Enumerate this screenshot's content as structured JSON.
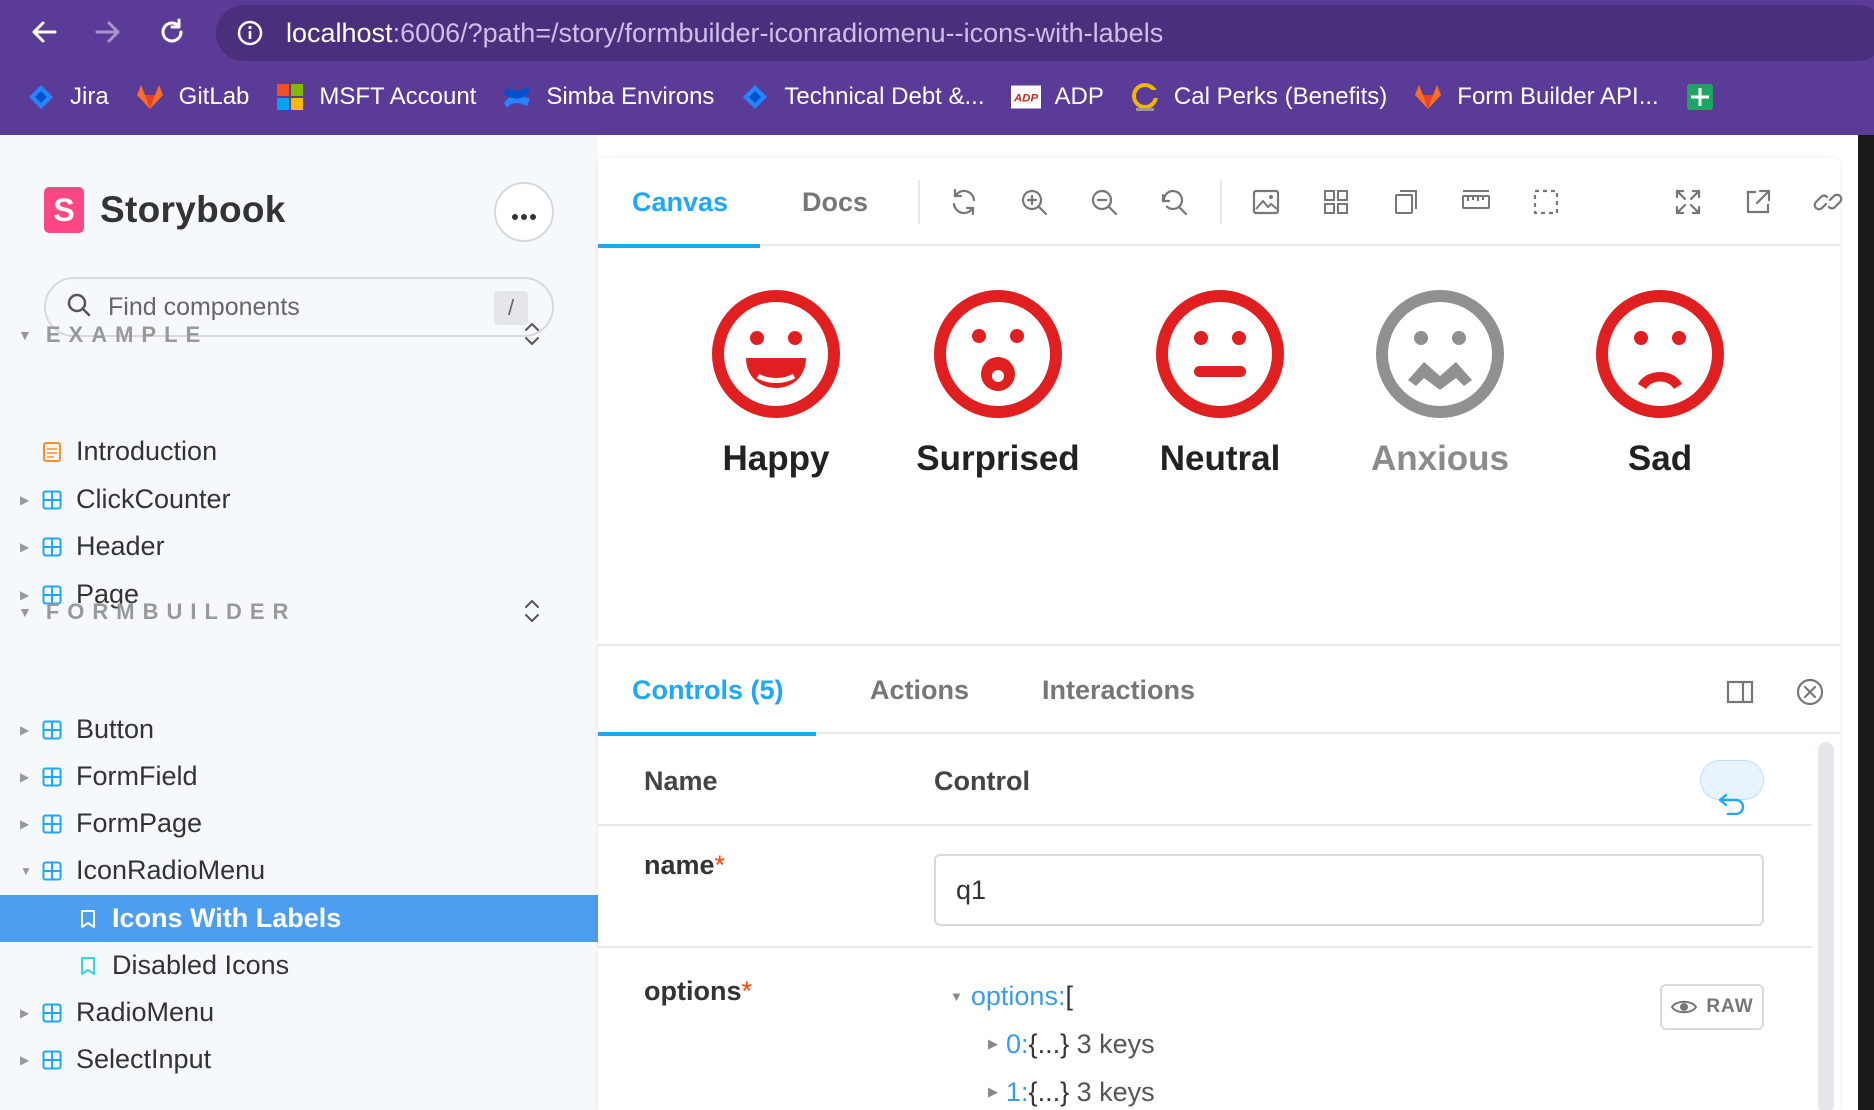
{
  "browser": {
    "url_host": "localhost",
    "url_rest": ":6006/?path=/story/formbuilder-iconradiomenu--icons-with-labels",
    "bookmarks": [
      {
        "label": "Jira",
        "icon": "jira-icon"
      },
      {
        "label": "GitLab",
        "icon": "gitlab-icon"
      },
      {
        "label": "MSFT Account",
        "icon": "microsoft-icon"
      },
      {
        "label": "Simba Environs",
        "icon": "confluence-icon"
      },
      {
        "label": "Technical Debt &...",
        "icon": "jira-icon"
      },
      {
        "label": "ADP",
        "icon": "adp-icon"
      },
      {
        "label": "Cal Perks (Benefits)",
        "icon": "calperks-icon"
      },
      {
        "label": "Form Builder API...",
        "icon": "gitlab-icon"
      }
    ]
  },
  "sidebar": {
    "brand": "Storybook",
    "search_placeholder": "Find components",
    "search_shortcut": "/",
    "sections": [
      {
        "title": "EXAMPLE",
        "items": [
          {
            "label": "Introduction",
            "kind": "doc"
          },
          {
            "label": "ClickCounter",
            "kind": "component"
          },
          {
            "label": "Header",
            "kind": "component"
          },
          {
            "label": "Page",
            "kind": "component"
          }
        ]
      },
      {
        "title": "FORMBUILDER",
        "items": [
          {
            "label": "Button",
            "kind": "component"
          },
          {
            "label": "FormField",
            "kind": "component"
          },
          {
            "label": "FormPage",
            "kind": "component"
          },
          {
            "label": "IconRadioMenu",
            "kind": "component",
            "expanded": true
          },
          {
            "label": "Icons With Labels",
            "kind": "story",
            "selected": true
          },
          {
            "label": "Disabled Icons",
            "kind": "story"
          },
          {
            "label": "RadioMenu",
            "kind": "component"
          },
          {
            "label": "SelectInput",
            "kind": "component"
          }
        ]
      }
    ]
  },
  "toolbar": {
    "tabs": [
      "Canvas",
      "Docs"
    ],
    "active_tab": "Canvas"
  },
  "canvas": {
    "faces": [
      {
        "label": "Happy",
        "mood": "happy",
        "disabled": false
      },
      {
        "label": "Surprised",
        "mood": "surprised",
        "disabled": false
      },
      {
        "label": "Neutral",
        "mood": "neutral",
        "disabled": false
      },
      {
        "label": "Anxious",
        "mood": "anxious",
        "disabled": true
      },
      {
        "label": "Sad",
        "mood": "sad",
        "disabled": false
      }
    ],
    "colors": {
      "active": "#e02020",
      "disabled": "#909090"
    }
  },
  "addons": {
    "tabs": [
      "Controls (5)",
      "Actions",
      "Interactions"
    ],
    "active_tab": "Controls (5)",
    "columns": {
      "name": "Name",
      "control": "Control"
    },
    "rows": {
      "name": {
        "label": "name",
        "required": "*",
        "value": "q1"
      },
      "options": {
        "label": "options",
        "required": "*",
        "tree_root_key": "options",
        "tree_root_sep": " : ",
        "tree_root_open": "[",
        "children": [
          {
            "key": "0",
            "sep": " : ",
            "value": "{...}",
            "meta": "3 keys"
          },
          {
            "key": "1",
            "sep": " : ",
            "value": "{...}",
            "meta": "3 keys"
          }
        ],
        "raw_label": "RAW"
      }
    }
  },
  "accent": "#1ea7fd"
}
